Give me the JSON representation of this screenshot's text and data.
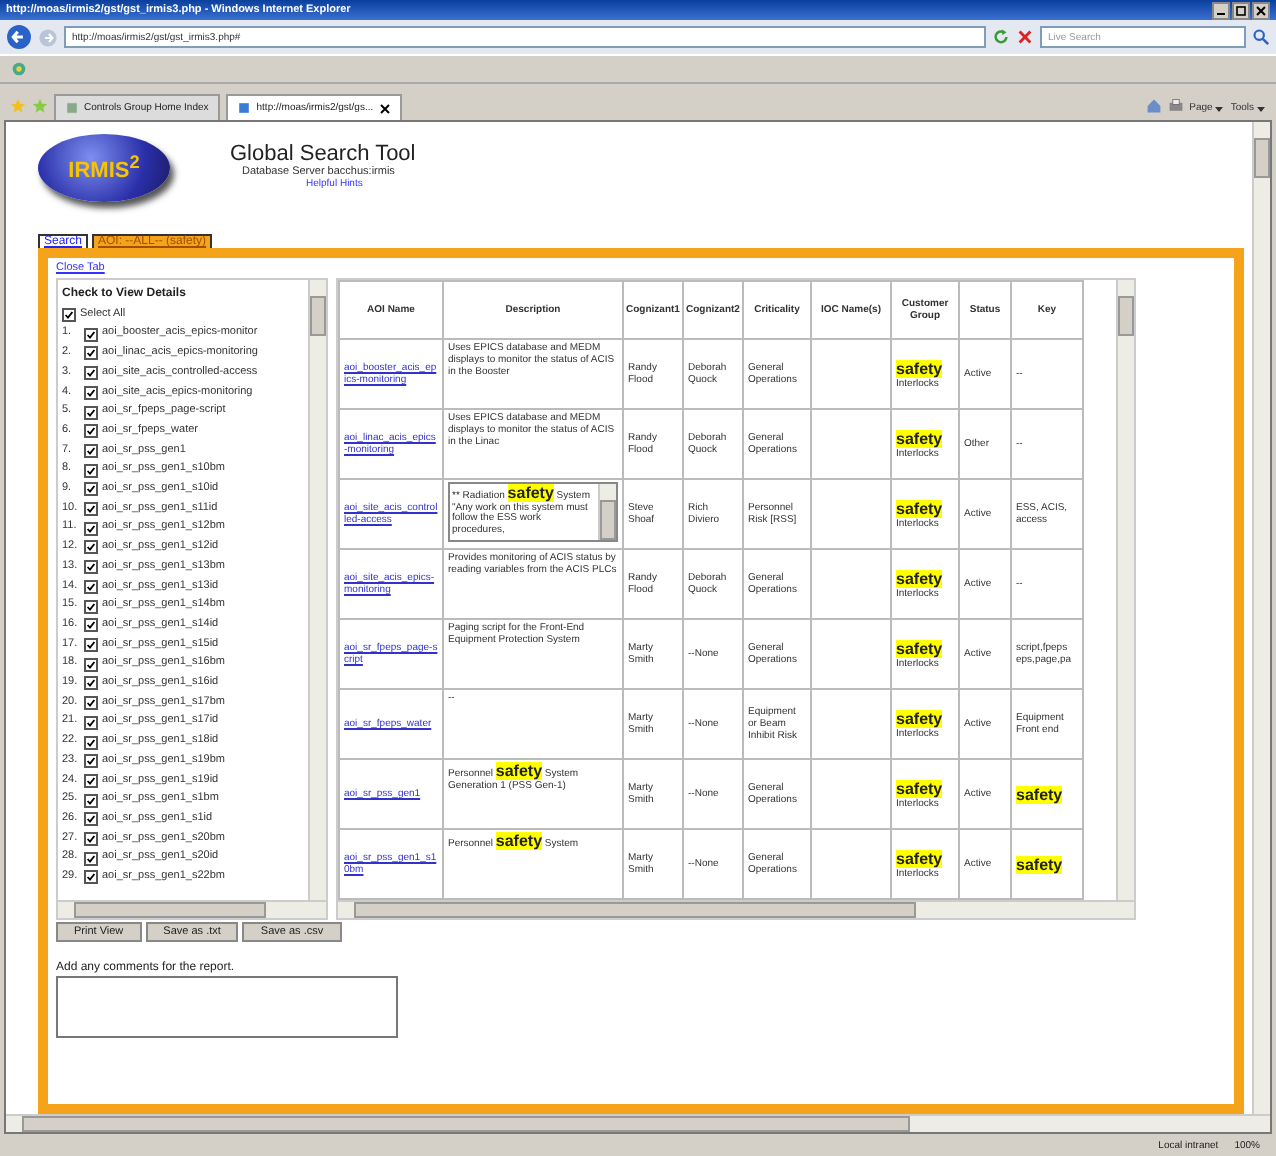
{
  "browser": {
    "title": "http://moas/irmis2/gst/gst_irmis3.php - Windows Internet Explorer",
    "address": "http://moas/irmis2/gst/gst_irmis3.php#",
    "search_placeholder": "Live Search",
    "tabs": [
      {
        "label": "Controls Group Home Index",
        "selected": false
      },
      {
        "label": "http://moas/irmis2/gst/gs...",
        "selected": true
      }
    ],
    "tools": [
      "Page",
      "Tools"
    ],
    "zone": "Local intranet",
    "zoom": "100%"
  },
  "header": {
    "logo": "IRMIS$^{2}$",
    "title": "Global Search Tool",
    "server": "Database Server bacchus:irmis",
    "hints": "Helpful Hints"
  },
  "page_tabs": [
    {
      "label": "Search",
      "selected": false
    },
    {
      "label": "AOI: --ALL-- (safety)",
      "selected": true
    }
  ],
  "close_tab": "Close Tab",
  "aoi_list": {
    "heading": "Check to View Details",
    "select_all": {
      "label": "Select All",
      "checked": true
    },
    "items": [
      {
        "number": "1.",
        "label": "aoi_booster_acis_epics-monitor",
        "checked": true
      },
      {
        "number": "2.",
        "label": "aoi_linac_acis_epics-monitoring",
        "checked": true
      },
      {
        "number": "3.",
        "label": "aoi_site_acis_controlled-access",
        "checked": true
      },
      {
        "number": "4.",
        "label": "aoi_site_acis_epics-monitoring",
        "checked": true
      },
      {
        "number": "5.",
        "label": "aoi_sr_fpeps_page-script",
        "checked": true
      },
      {
        "number": "6.",
        "label": "aoi_sr_fpeps_water",
        "checked": true
      },
      {
        "number": "7.",
        "label": "aoi_sr_pss_gen1",
        "checked": true
      },
      {
        "number": "8.",
        "label": "aoi_sr_pss_gen1_s10bm",
        "checked": true
      },
      {
        "number": "9.",
        "label": "aoi_sr_pss_gen1_s10id",
        "checked": true
      },
      {
        "number": "10.",
        "label": "aoi_sr_pss_gen1_s11id",
        "checked": true
      },
      {
        "number": "11.",
        "label": "aoi_sr_pss_gen1_s12bm",
        "checked": true
      },
      {
        "number": "12.",
        "label": "aoi_sr_pss_gen1_s12id",
        "checked": true
      },
      {
        "number": "13.",
        "label": "aoi_sr_pss_gen1_s13bm",
        "checked": true
      },
      {
        "number": "14.",
        "label": "aoi_sr_pss_gen1_s13id",
        "checked": true
      },
      {
        "number": "15.",
        "label": "aoi_sr_pss_gen1_s14bm",
        "checked": true
      },
      {
        "number": "16.",
        "label": "aoi_sr_pss_gen1_s14id",
        "checked": true
      },
      {
        "number": "17.",
        "label": "aoi_sr_pss_gen1_s15id",
        "checked": true
      },
      {
        "number": "18.",
        "label": "aoi_sr_pss_gen1_s16bm",
        "checked": true
      },
      {
        "number": "19.",
        "label": "aoi_sr_pss_gen1_s16id",
        "checked": true
      },
      {
        "number": "20.",
        "label": "aoi_sr_pss_gen1_s17bm",
        "checked": true
      },
      {
        "number": "21.",
        "label": "aoi_sr_pss_gen1_s17id",
        "checked": true
      },
      {
        "number": "22.",
        "label": "aoi_sr_pss_gen1_s18id",
        "checked": true
      },
      {
        "number": "23.",
        "label": "aoi_sr_pss_gen1_s19bm",
        "checked": true
      },
      {
        "number": "24.",
        "label": "aoi_sr_pss_gen1_s19id",
        "checked": true
      },
      {
        "number": "25.",
        "label": "aoi_sr_pss_gen1_s1bm",
        "checked": true
      },
      {
        "number": "26.",
        "label": "aoi_sr_pss_gen1_s1id",
        "checked": true
      },
      {
        "number": "27.",
        "label": "aoi_sr_pss_gen1_s20bm",
        "checked": true
      },
      {
        "number": "28.",
        "label": "aoi_sr_pss_gen1_s20id",
        "checked": true
      },
      {
        "number": "29.",
        "label": "aoi_sr_pss_gen1_s22bm",
        "checked": true
      }
    ]
  },
  "table": {
    "columns": [
      "AOI Name",
      "Description",
      "Cognizant1",
      "Cognizant2",
      "Criticality",
      "IOC Name(s)",
      "Customer Group",
      "Status",
      "Key"
    ],
    "rows": [
      {
        "kind": "text",
        "cells": [
          "aoi_booster_acis_epics-monitoring",
          "Uses EPICS database and MEDM displays to monitor the status of ACIS in the Booster",
          "Randy Flood",
          "Deborah Quock",
          "General Operations",
          "",
          "**safety** Interlocks",
          "Active",
          "--"
        ]
      },
      {
        "kind": "text",
        "cells": [
          "aoi_linac_acis_epics-monitoring",
          "Uses EPICS database and MEDM displays to monitor the status of ACIS in the Linac",
          "Randy Flood",
          "Deborah Quock",
          "General Operations",
          "",
          "**safety** Interlocks",
          "Other",
          "--"
        ]
      },
      {
        "kind": "scrollbox",
        "cells": [
          "aoi_site_acis_controlled-access",
          "** Radiation **safety** System \"Any work on this system must follow the ESS work procedures,",
          "Steve Shoaf",
          "Rich Diviero",
          "Personnel Risk [RSS]",
          "",
          "**safety** Interlocks",
          "Active",
          "ESS, ACIS, access"
        ]
      },
      {
        "kind": "text",
        "cells": [
          "aoi_site_acis_epics-monitoring",
          "Provides monitoring of ACIS status by reading variables from the ACIS PLCs",
          "Randy Flood",
          "Deborah Quock",
          "General Operations",
          "",
          "**safety** Interlocks",
          "Active",
          "--"
        ]
      },
      {
        "kind": "text",
        "cells": [
          "aoi_sr_fpeps_page-script",
          "Paging script for the Front-End Equipment Protection System",
          "Marty Smith",
          "--None",
          "General Operations",
          "",
          "**safety** Interlocks",
          "Active",
          "script,fpeps eps,page,pa"
        ]
      },
      {
        "kind": "text",
        "cells": [
          "aoi_sr_fpeps_water",
          "--",
          "Marty Smith",
          "--None",
          "Equipment or Beam Inhibit Risk",
          "",
          "**safety** Interlocks",
          "Active",
          "Equipment Front end"
        ]
      },
      {
        "kind": "text",
        "cells": [
          "aoi_sr_pss_gen1",
          "Personnel **safety** System Generation 1 (PSS Gen-1)",
          "Marty Smith",
          "--None",
          "General Operations",
          "",
          "**safety** Interlocks",
          "Active",
          "**safety**"
        ]
      },
      {
        "kind": "text",
        "cells": [
          "aoi_sr_pss_gen1_s10bm",
          "Personnel **safety** System",
          "Marty Smith",
          "--None",
          "General Operations",
          "",
          "**safety** Interlocks",
          "Active",
          "**safety**"
        ]
      }
    ]
  },
  "buttons": [
    "Print View",
    "Save as .txt",
    "Save as .csv"
  ],
  "comments": {
    "label": "Add any comments for the report."
  }
}
